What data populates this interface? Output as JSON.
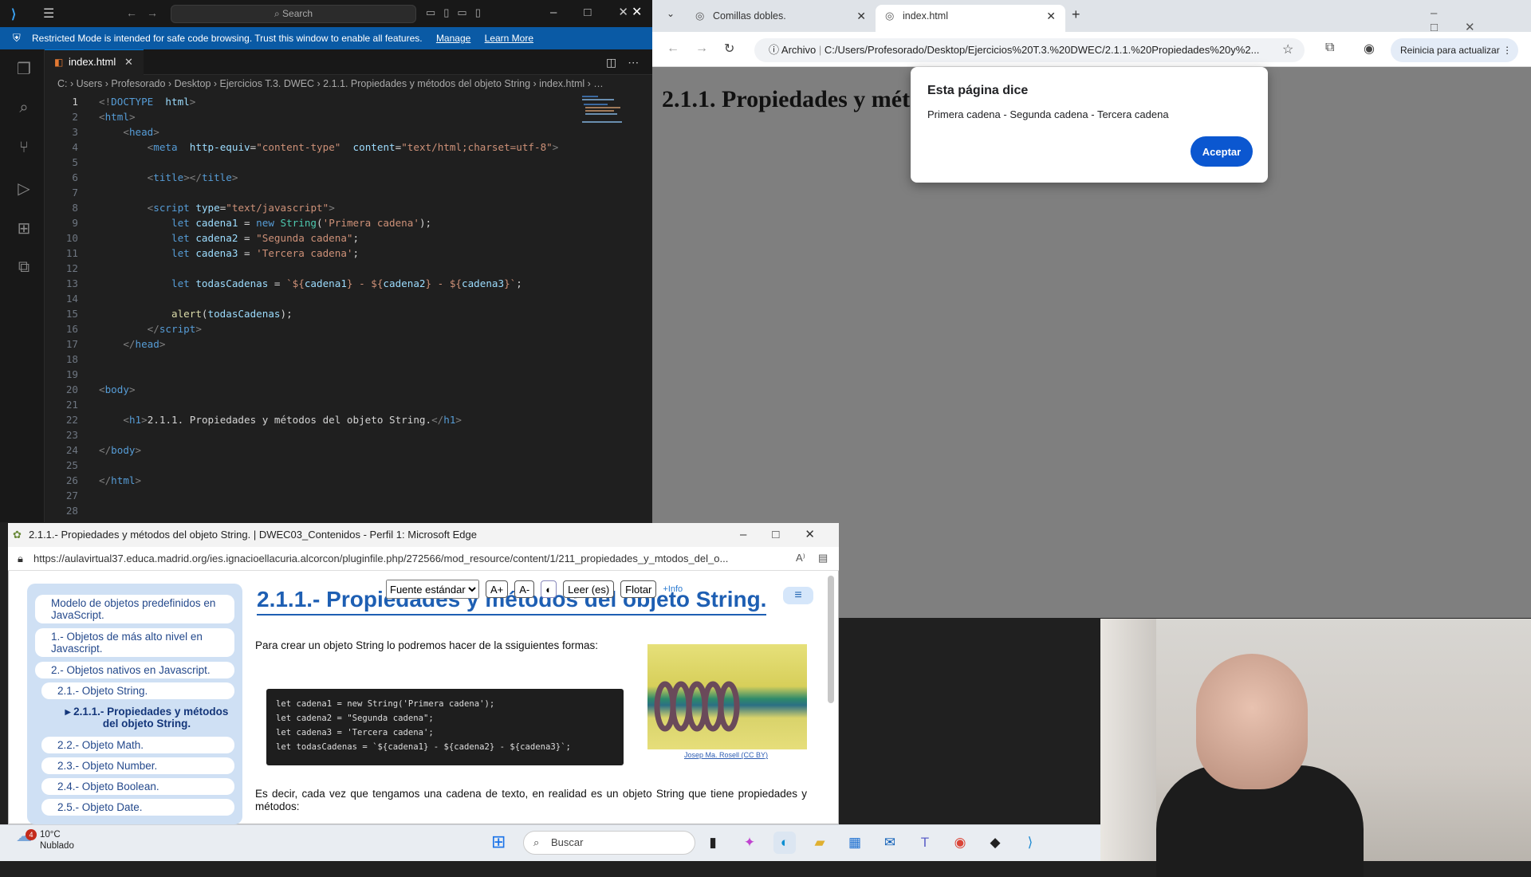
{
  "vscode": {
    "search_placeholder": "Search",
    "banner_text": "Restricted Mode is intended for safe code browsing. Trust this window to enable all features.",
    "banner_manage": "Manage",
    "banner_learn": "Learn More",
    "tab_name": "index.html",
    "breadcrumb": "C: › Users › Profesorado › Desktop › Ejercicios T.3. DWEC › 2.1.1. Propiedades y métodos del objeto String › index.html › …"
  },
  "code_lines": [
    "1",
    "2",
    "3",
    "4",
    "5",
    "6",
    "7",
    "8",
    "9",
    "10",
    "11",
    "12",
    "13",
    "14",
    "15",
    "16",
    "17",
    "18",
    "19",
    "20",
    "21",
    "22",
    "23",
    "24",
    "25",
    "26",
    "27",
    "28"
  ],
  "chrome": {
    "tab1": "Comillas dobles.",
    "tab2": "index.html",
    "new_tab": "+",
    "archivo": "Archivo",
    "url": "C:/Users/Profesorado/Desktop/Ejercicios%20T.3.%20DWEC/2.1.1.%20Propiedades%20y%2...",
    "update": "Reinicia para actualizar",
    "page_h1": "2.1.1. Propiedades y métodos del objeto String.",
    "dialog_title": "Esta página dice",
    "dialog_message": "Primera cadena - Segunda cadena - Tercera cadena",
    "dialog_ok": "Aceptar"
  },
  "edge": {
    "title": "2.1.1.- Propiedades y métodos del objeto String. | DWEC03_Contenidos - Perfil 1: Microsoft Edge",
    "url": "https://aulavirtual37.educa.madrid.org/ies.ignacioellacuria.alcorcon/pluginfile.php/272566/mod_resource/content/1/211_propiedades_y_mtodos_del_o...",
    "nav": [
      "Modelo de objetos predefinidos en JavaScript.",
      "1.- Objetos de más alto nivel en Javascript.",
      "2.- Objetos nativos en Javascript.",
      "2.1.- Objeto String.",
      "2.1.1.- Propiedades y métodos del objeto String.",
      "2.2.- Objeto Math.",
      "2.3.- Objeto Number.",
      "2.4.- Objeto Boolean.",
      "2.5.- Objeto Date."
    ],
    "heading": "2.1.1.- Propiedades y métodos del objeto String.",
    "font_select": "Fuente estándar",
    "btn_aplus": "A+",
    "btn_aminus": "A-",
    "btn_read": "Leer (es)",
    "btn_float": "Flotar",
    "info": "+Info",
    "para1": "Para crear un objeto String lo podremos hacer de la ssiguientes formas:",
    "code": [
      "let cadena1 = new String('Primera cadena');",
      "let cadena2 = \"Segunda cadena\";",
      "let cadena3 = 'Tercera cadena';",
      "let todasCadenas = `${cadena1} - ${cadena2} - ${cadena3}`;"
    ],
    "credit": "Josep Ma. Rosell (CC BY)",
    "para2": "Es decir, cada vez que tengamos una cadena de texto, en realidad es un objeto String que tiene propiedades y métodos:"
  },
  "taskbar": {
    "temp": "10°C",
    "weather": "Nublado",
    "badge": "4",
    "search": "Buscar"
  }
}
